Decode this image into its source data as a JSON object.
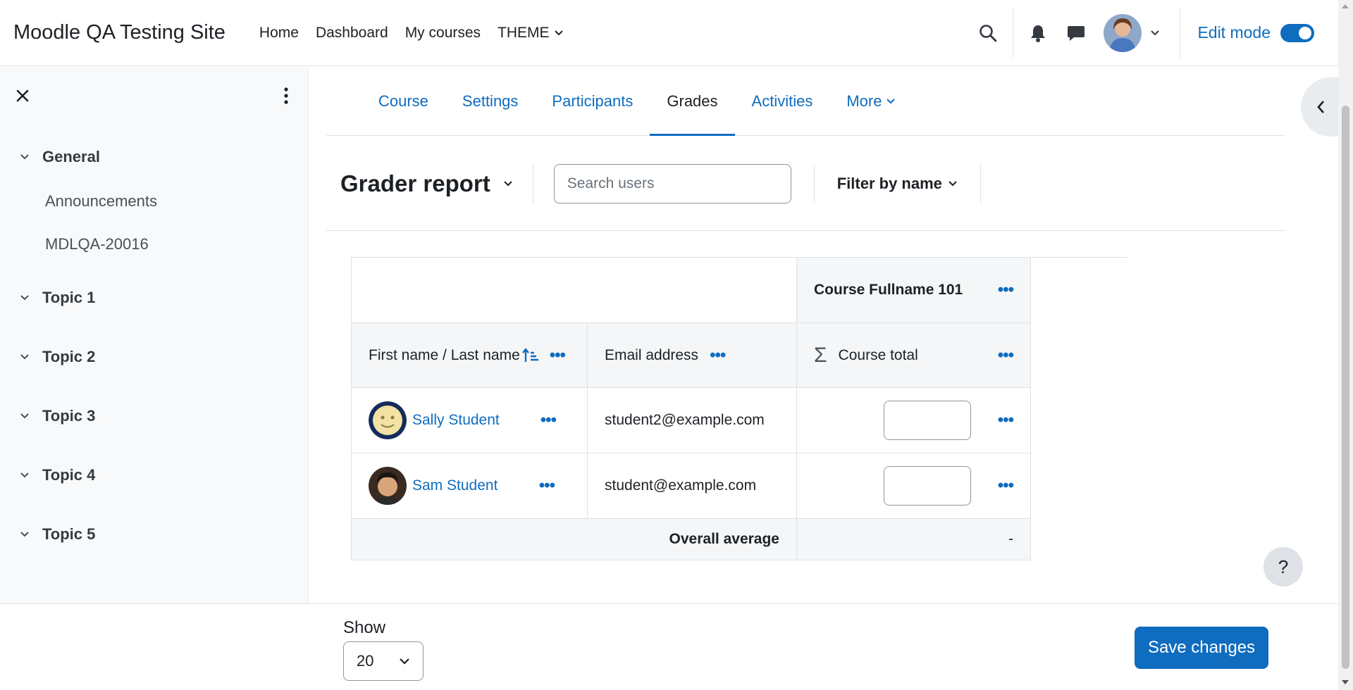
{
  "site_name": "Moodle QA Testing Site",
  "primary_nav": [
    "Home",
    "Dashboard",
    "My courses",
    "THEME"
  ],
  "header": {
    "edit_mode_label": "Edit mode",
    "edit_mode_on": true
  },
  "drawer": {
    "sections": [
      {
        "title": "General",
        "items": [
          "Announcements",
          "MDLQA-20016"
        ]
      },
      {
        "title": "Topic 1",
        "items": []
      },
      {
        "title": "Topic 2",
        "items": []
      },
      {
        "title": "Topic 3",
        "items": []
      },
      {
        "title": "Topic 4",
        "items": []
      },
      {
        "title": "Topic 5",
        "items": []
      }
    ]
  },
  "secondary_nav": {
    "tabs": [
      "Course",
      "Settings",
      "Participants",
      "Grades",
      "Activities",
      "More"
    ],
    "active": "Grades"
  },
  "report": {
    "title": "Grader report",
    "search_placeholder": "Search users",
    "filter_label": "Filter by name"
  },
  "grader": {
    "course_name": "Course Fullname 101",
    "col_name": "First name / Last name",
    "col_email": "Email address",
    "col_total": "Course total",
    "total_symbol": "Σ",
    "students": [
      {
        "name": "Sally Student",
        "email": "student2@example.com",
        "grade": ""
      },
      {
        "name": "Sam Student",
        "email": "student@example.com",
        "grade": ""
      }
    ],
    "average_label": "Overall average",
    "average_value": "-"
  },
  "help_label": "?",
  "footer": {
    "show_label": "Show",
    "per_page": "20",
    "save_label": "Save changes"
  },
  "colors": {
    "brand": "#0f6cbf",
    "drawer_bg": "#f8f9fa"
  }
}
